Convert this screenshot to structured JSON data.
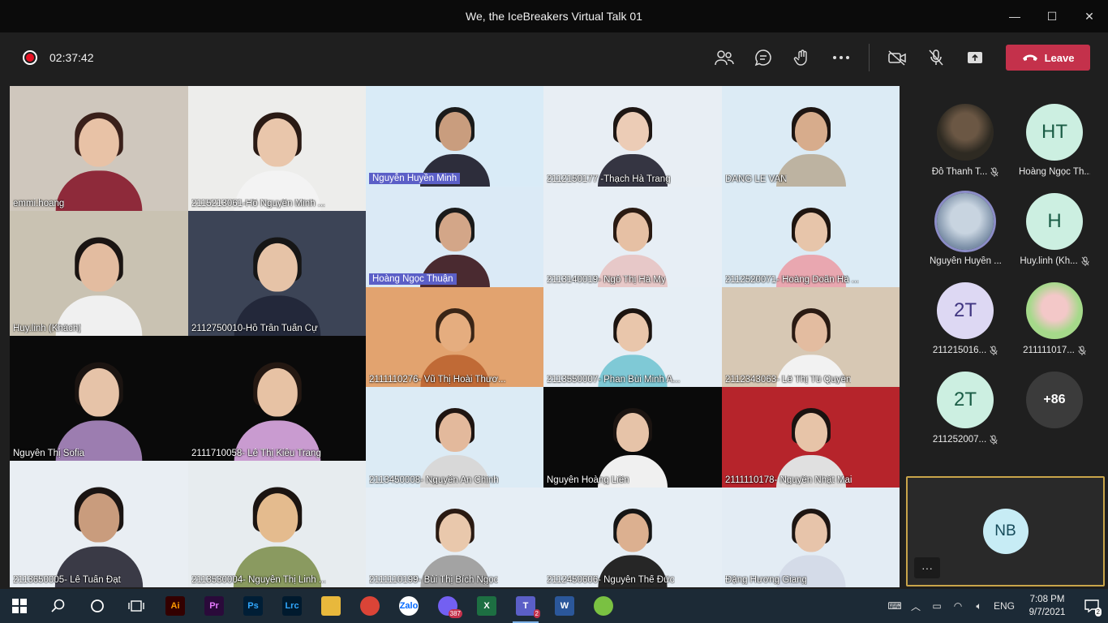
{
  "window": {
    "title": "We, the IceBreakers Virtual Talk 01",
    "minimize": "—",
    "maximize": "☐",
    "close": "✕"
  },
  "toolbar": {
    "timer": "02:37:42",
    "leave_label": "Leave"
  },
  "gallery": [
    {
      "label": "emmi.hoang",
      "boxed": false,
      "bg": "#cfc7bd",
      "skin": "#e8c2a6",
      "shirt": "#8e2a3a",
      "hair": "#3a201a"
    },
    {
      "label": "2115213061-Hồ Nguyễn Minh ...",
      "boxed": false,
      "bg": "#ededeb",
      "skin": "#e9c6ab",
      "shirt": "#f3f3f3",
      "hair": "#2a1a14"
    },
    {
      "label": "Nguyễn Huyền Minh",
      "boxed": true,
      "bg": "#d9ebf7",
      "skin": "#c99d7e",
      "shirt": "#2d2d3b",
      "hair": "#1b1b1b"
    },
    {
      "label": "2112150177 -Thạch Hà Trang",
      "boxed": false,
      "bg": "#e8eef4",
      "skin": "#ecccb6",
      "shirt": "#353542",
      "hair": "#1e1613"
    },
    {
      "label": "DANG LE VAN",
      "boxed": false,
      "bg": "#dcebf5",
      "skin": "#d7ac8c",
      "shirt": "#bdb3a1",
      "hair": "#1d1512"
    },
    {
      "label": "Huy.linh (Khách)",
      "boxed": false,
      "bg": "#c9c2b2",
      "skin": "#e3bca0",
      "shirt": "#f0f0f0",
      "hair": "#1a1412"
    },
    {
      "label": "2112750010-Hồ Trần Tuấn Cự",
      "boxed": false,
      "bg": "#3c4456",
      "skin": "#e6c3a7",
      "shirt": "#23283a",
      "hair": "#161616"
    },
    {
      "label": "Hoàng Ngọc Thuận",
      "boxed": true,
      "bg": "#dbeaf6",
      "skin": "#d3a688",
      "shirt": "#4a2a30",
      "hair": "#1a1a1a"
    },
    {
      "label": "2113140019- Ngô Thị Hà My",
      "boxed": false,
      "bg": "#e7eef5",
      "skin": "#e6c0a4",
      "shirt": "#e7c8c8",
      "hair": "#2a1a12"
    },
    {
      "label": "2112520071- Hoàng Doãn Hà ...",
      "boxed": false,
      "bg": "#dcebf5",
      "skin": "#e7c5aa",
      "shirt": "#e9a7b0",
      "hair": "#1f1510"
    },
    {
      "label": "Nguyễn Thị Sofia",
      "boxed": false,
      "bg": "#0a0a0a",
      "skin": "#e6c3a8",
      "shirt": "#9c7db0",
      "hair": "#1b1411"
    },
    {
      "label": "2111710058- Lê Thị Kiều Trang",
      "boxed": false,
      "bg": "#0a0a0a",
      "skin": "#e7c2a4",
      "shirt": "#c99bd0",
      "hair": "#241812"
    },
    {
      "label": "2111110276- Vũ Thị Hoài Thươ...",
      "boxed": false,
      "bg": "#e2a36f",
      "skin": "#e5ad7f",
      "shirt": "#c06a36",
      "hair": "#3a2516"
    },
    {
      "label": "2113550007- Phan Bùi Minh A...",
      "boxed": false,
      "bg": "#e6eef5",
      "skin": "#e9c6ab",
      "shirt": "#7fc9d6",
      "hair": "#1c1410"
    },
    {
      "label": "2112343063- Lê Thị Tú Quyên",
      "boxed": false,
      "bg": "#d7c8b4",
      "skin": "#e3bca0",
      "shirt": "#f2f2f2",
      "hair": "#2a1a12"
    },
    {
      "label": "2113450008- Nguyễn An Chinh",
      "boxed": false,
      "bg": "#dcebf5",
      "skin": "#e3b99c",
      "shirt": "#d8d8d8",
      "hair": "#1f1512"
    },
    {
      "label": "Nguyễn Hoàng Liên",
      "boxed": false,
      "bg": "#0a0a0a",
      "skin": "#e6c3a8",
      "shirt": "#f0f0f0",
      "hair": "#1b1411"
    },
    {
      "label": "2111110178- Nguyễn Nhật Mai",
      "boxed": false,
      "bg": "#b6242b",
      "skin": "#e7c4a8",
      "shirt": "#e0e0e0",
      "hair": "#1a1210"
    },
    {
      "label": "2113650005- Lê Tuấn Đạt",
      "boxed": false,
      "bg": "#e9eef3",
      "skin": "#c99c7d",
      "shirt": "#3a3a46",
      "hair": "#1a1412"
    },
    {
      "label": "2113530004- Nguyễn Thị Linh ...",
      "boxed": false,
      "bg": "#e7ecef",
      "skin": "#e4bb8e",
      "shirt": "#8a9a60",
      "hair": "#1b1411"
    },
    {
      "label": "2111110199- Bùi Thị Bích Ngọc",
      "boxed": false,
      "bg": "#e6eef5",
      "skin": "#e9c8ac",
      "shirt": "#a3a3a3",
      "hair": "#2a1a12"
    },
    {
      "label": "2112450606- Nguyễn Thế Đức",
      "boxed": false,
      "bg": "#e6eef5",
      "skin": "#dcb090",
      "shirt": "#262626",
      "hair": "#151515"
    },
    {
      "label": "Đặng Hương Giang",
      "boxed": false,
      "bg": "#e3ecf4",
      "skin": "#e7c4aa",
      "shirt": "#d4dbe8",
      "hair": "#1d1512"
    }
  ],
  "participants": [
    {
      "name": "Đỗ Thanh T...",
      "initials": "",
      "style": "photo1",
      "muted": true
    },
    {
      "name": "Hoàng Ngọc Th...",
      "initials": "HT",
      "style": "teal",
      "muted": false
    },
    {
      "name": "Nguyễn Huyền ...",
      "initials": "",
      "style": "photo2",
      "muted": false
    },
    {
      "name": "Huy.linh (Kh...",
      "initials": "H",
      "style": "teal",
      "muted": true
    },
    {
      "name": "211215016...",
      "initials": "2T",
      "style": "lav",
      "muted": true
    },
    {
      "name": "211111017...",
      "initials": "",
      "style": "photo3",
      "muted": true
    },
    {
      "name": "211252007...",
      "initials": "2T",
      "style": "teal",
      "muted": true
    },
    {
      "name": "",
      "initials": "+86",
      "style": "dark",
      "muted": false
    }
  ],
  "self_view": {
    "initials": "NB",
    "more_label": "···"
  },
  "taskbar": {
    "apps": [
      {
        "name": "illustrator",
        "label": "Ai",
        "bg": "#330000",
        "fg": "#ff9a00"
      },
      {
        "name": "premiere",
        "label": "Pr",
        "bg": "#2a0a3a",
        "fg": "#e77bff"
      },
      {
        "name": "photoshop",
        "label": "Ps",
        "bg": "#001e36",
        "fg": "#31a8ff"
      },
      {
        "name": "lightroom-classic",
        "label": "Lrc",
        "bg": "#001a2e",
        "fg": "#31a8ff"
      },
      {
        "name": "file-explorer",
        "label": "",
        "bg": "#e8b83c",
        "fg": "#e8b83c"
      },
      {
        "name": "chrome",
        "label": "",
        "bg": "#db4437",
        "fg": "#fff"
      },
      {
        "name": "zalo",
        "label": "Zalo",
        "bg": "#ffffff",
        "fg": "#0068ff"
      },
      {
        "name": "viber",
        "label": "",
        "bg": "#7360f2",
        "fg": "#fff",
        "badge": "387"
      },
      {
        "name": "excel",
        "label": "X",
        "bg": "#1d6f42",
        "fg": "#fff"
      },
      {
        "name": "teams",
        "label": "T",
        "bg": "#5b5fc7",
        "fg": "#fff",
        "badge": "2",
        "active": true
      },
      {
        "name": "word",
        "label": "W",
        "bg": "#2b579a",
        "fg": "#fff"
      },
      {
        "name": "other-app",
        "label": "",
        "bg": "#7ac142",
        "fg": "#fff"
      }
    ],
    "input_language": "ENG",
    "time": "7:08 PM",
    "date": "9/7/2021",
    "notification_count": "2"
  }
}
